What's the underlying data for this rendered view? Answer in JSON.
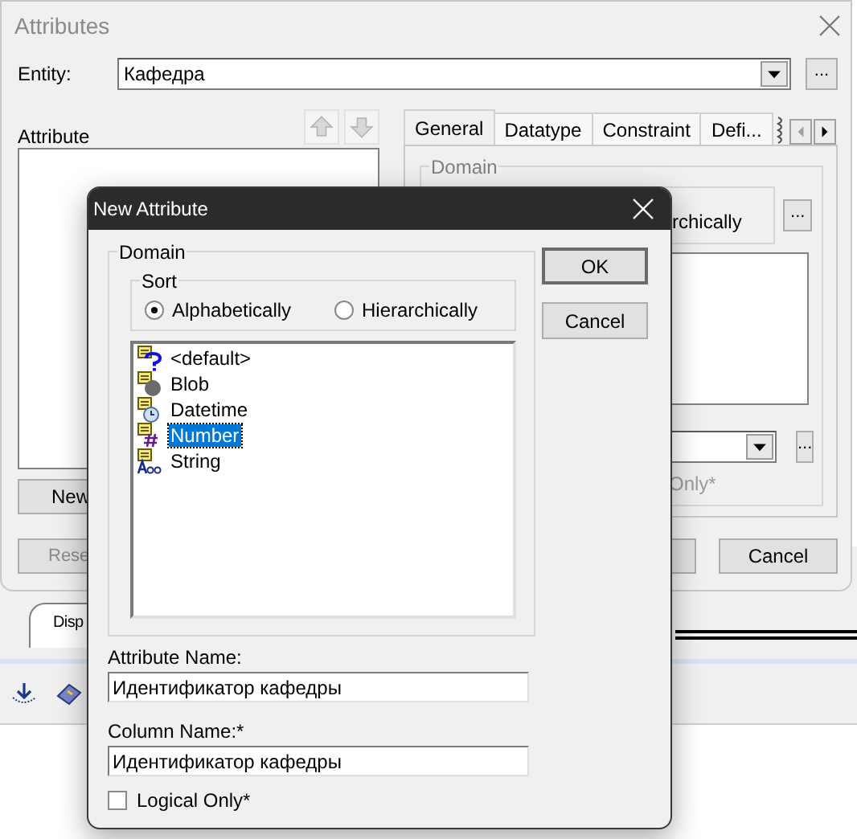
{
  "window": {
    "title": "Attributes"
  },
  "entity": {
    "label": "Entity:",
    "value": "Кафедра",
    "browse": "..."
  },
  "attribute_list": {
    "label": "Attribute"
  },
  "left_buttons": [
    {
      "label": "New",
      "disabled": false
    },
    {
      "label": "Rese",
      "disabled": true
    }
  ],
  "tabs": [
    {
      "label": "General",
      "selected": true
    },
    {
      "label": "Datatype",
      "selected": false
    },
    {
      "label": "Constraint",
      "selected": false
    },
    {
      "label": "Defi...",
      "selected": false
    }
  ],
  "tab_panel": {
    "group_label": "Domain",
    "option_label": "rchically",
    "browse": "...",
    "combo_browse": "...",
    "checkbox_label": "Only*"
  },
  "footer_buttons": [
    {
      "kind": "hidden"
    },
    {
      "kind": "text",
      "label": "Cancel"
    }
  ],
  "background_tab": {
    "label": "Disp"
  },
  "dialog": {
    "title": "New Attribute",
    "domain_label": "Domain",
    "sort": {
      "label": "Sort",
      "options": [
        {
          "label": "Alphabetically",
          "selected": true
        },
        {
          "label": "Hierarchically",
          "selected": false
        }
      ]
    },
    "types": [
      {
        "kind": "default",
        "label": "<default>",
        "selected": false
      },
      {
        "kind": "blob",
        "label": "Blob",
        "selected": false
      },
      {
        "kind": "datetime",
        "label": "Datetime",
        "selected": false
      },
      {
        "kind": "number",
        "label": "Number",
        "selected": true
      },
      {
        "kind": "string",
        "label": "String",
        "selected": false
      }
    ],
    "buttons": [
      "OK",
      "Cancel"
    ],
    "attribute_name": {
      "label": "Attribute Name:",
      "value": "Идентификатор кафедры"
    },
    "column_name": {
      "label": "Column Name:*",
      "value": "Идентификатор кафедры"
    },
    "logical_only": {
      "label": "Logical Only*",
      "checked": false
    }
  }
}
